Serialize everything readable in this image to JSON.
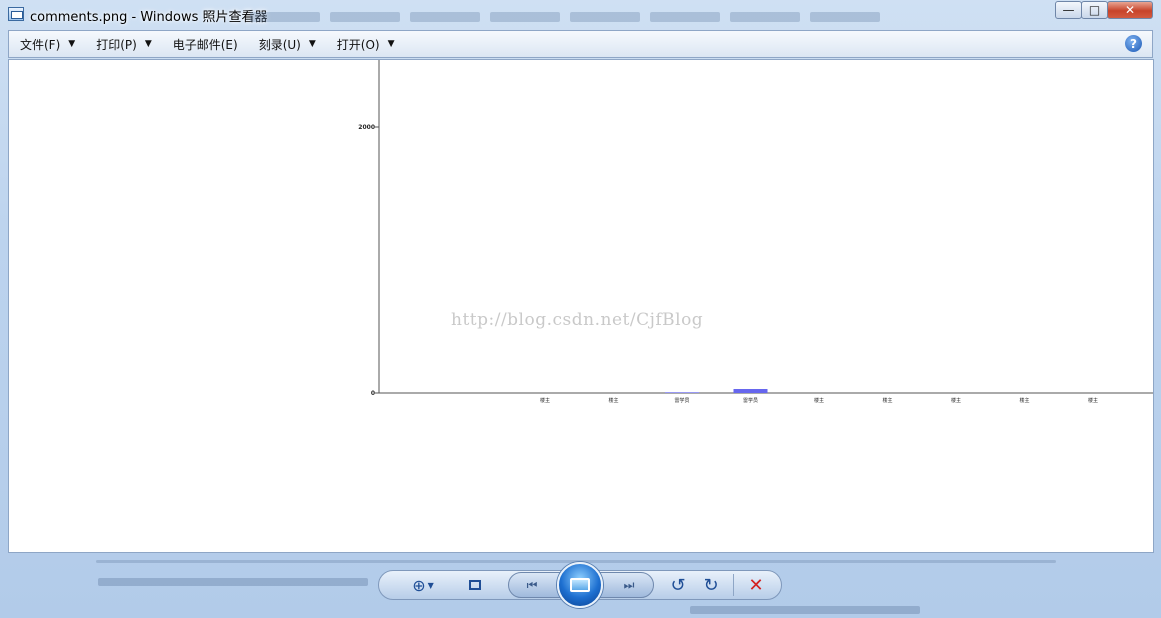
{
  "window": {
    "title": "comments.png - Windows 照片查看器",
    "minimize_label": "—",
    "maximize_label": "□",
    "close_label": "✕"
  },
  "menu": {
    "items": [
      {
        "label": "文件(F)",
        "has_dropdown": true
      },
      {
        "label": "打印(P)",
        "has_dropdown": true
      },
      {
        "label": "电子邮件(E)",
        "has_dropdown": false
      },
      {
        "label": "刻录(U)",
        "has_dropdown": true
      },
      {
        "label": "打开(O)",
        "has_dropdown": true
      }
    ],
    "help_label": "?"
  },
  "image": {
    "watermark": "http://blog.csdn.net/CjfBlog"
  },
  "chart_data": {
    "type": "bar",
    "categories": [
      "楼主",
      "楼主",
      "雷学员",
      "雷学员",
      "楼主",
      "楼主",
      "楼主",
      "楼主",
      "楼主"
    ],
    "values": [
      0,
      0,
      5,
      30,
      0,
      0,
      0,
      0,
      0
    ],
    "yticks": [
      0,
      2000
    ],
    "ylim": [
      0,
      2500
    ],
    "bar_color": "#6666ee",
    "title": "",
    "xlabel": "",
    "ylabel": ""
  },
  "toolbar": {
    "zoom_icon": "magnifier-plus-icon",
    "fit_icon": "actual-size-icon",
    "prev_icon": "previous-icon",
    "slideshow_icon": "slideshow-icon",
    "next_icon": "next-icon",
    "rotate_left_icon": "rotate-ccw-icon",
    "rotate_right_icon": "rotate-cw-icon",
    "delete_icon": "delete-icon"
  }
}
